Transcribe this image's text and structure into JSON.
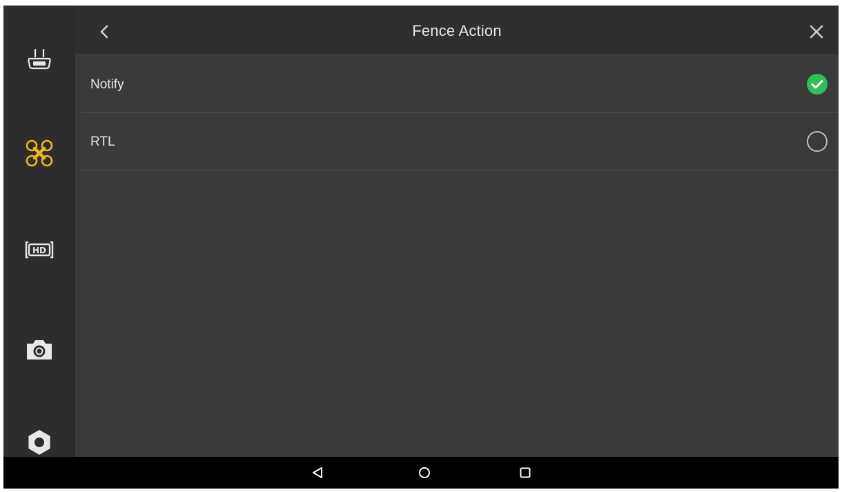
{
  "header": {
    "title": "Fence Action",
    "back_icon": "chevron-left-icon",
    "close_icon": "close-icon"
  },
  "options": [
    {
      "label": "Notify",
      "selected": true
    },
    {
      "label": "RTL",
      "selected": false
    }
  ],
  "sidebar": {
    "items": [
      {
        "icon": "remote-controller-icon",
        "active": false
      },
      {
        "icon": "aircraft-icon",
        "active": true
      },
      {
        "icon": "hd-video-icon",
        "active": false
      },
      {
        "icon": "camera-icon",
        "active": false
      },
      {
        "icon": "gear-icon",
        "active": false
      }
    ]
  },
  "system_nav": {
    "items": [
      "back-triangle-icon",
      "home-circle-icon",
      "recents-square-icon"
    ]
  },
  "colors": {
    "accent": "#f2b41c",
    "selected": "#2fbf5a",
    "background": "#3a3a3a",
    "rail": "#2d2d2d"
  }
}
